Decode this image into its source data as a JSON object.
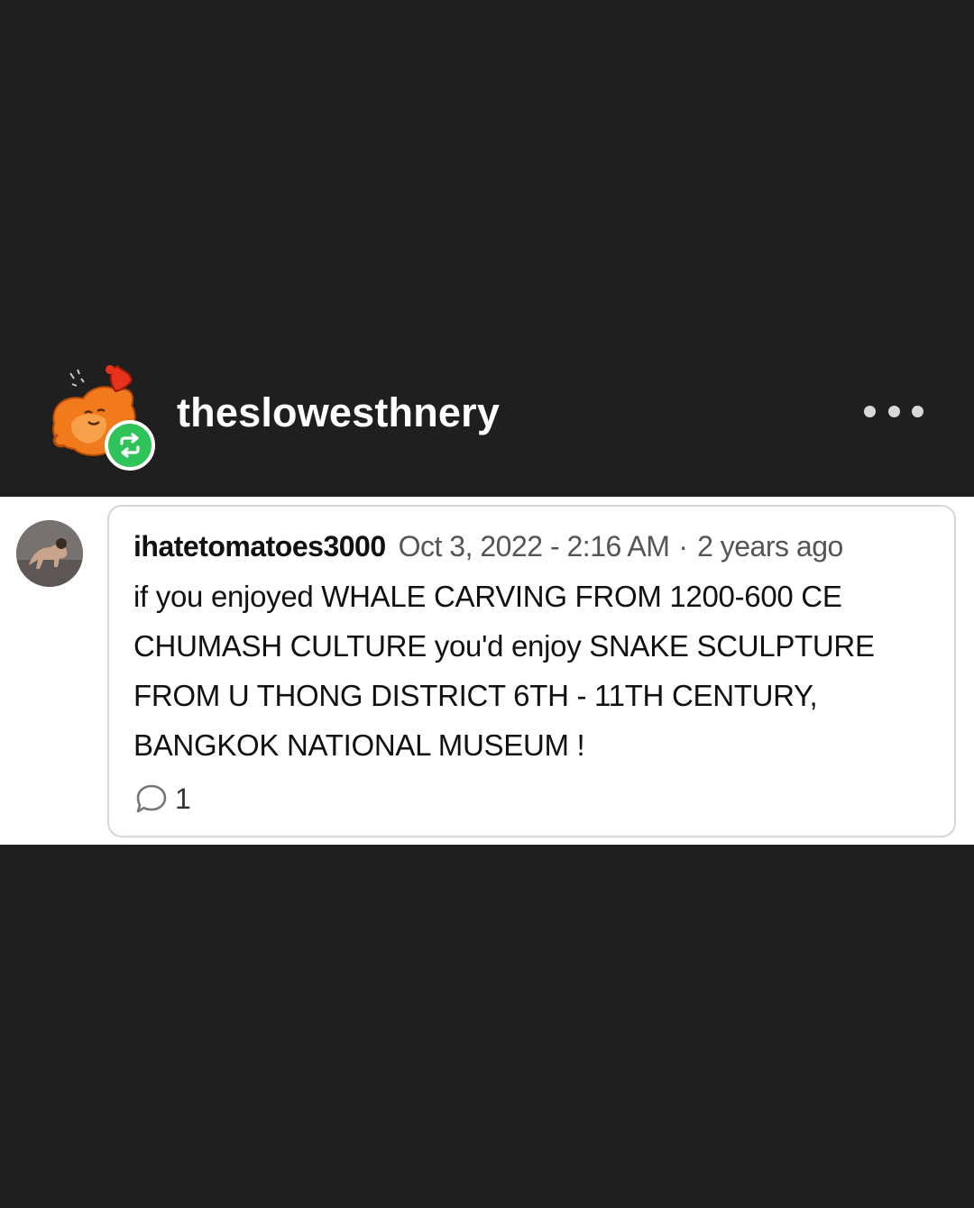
{
  "post": {
    "username": "theslowesthnery",
    "avatar_icon": "cartoon-character-avatar",
    "badge_icon": "reblog-icon",
    "badge_color": "#2fc35a",
    "more_icon": "more-options-icon"
  },
  "reply": {
    "author": "ihatetomatoes3000",
    "date": "Oct 3, 2022 - 2:16 AM",
    "separator": "·",
    "relative_time": "2 years ago",
    "body": "if you enjoyed WHALE CARVING FROM 1200-600 CE CHUMASH CULTURE you'd enjoy SNAKE SCULPTURE FROM U THONG DISTRICT 6TH - 11TH CENTURY, BANGKOK NATIONAL MUSEUM !",
    "reply_icon": "speech-bubble-icon",
    "reply_count": "1"
  },
  "colors": {
    "background": "#1f1f1f",
    "card_border": "#d6d6d6",
    "text": "#111111",
    "muted_text": "#555555"
  }
}
